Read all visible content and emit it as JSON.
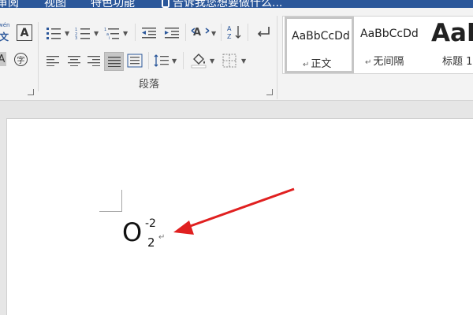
{
  "tabs": [
    {
      "label": "审阅"
    },
    {
      "label": "视图"
    },
    {
      "label": "特色功能"
    }
  ],
  "tell_me": {
    "text": "告诉我您想要做什么..."
  },
  "ribbon": {
    "pinyin_label": "wén",
    "pinyin_char": "文",
    "char_border_label": "A",
    "shading_label": "A",
    "enclose_label": "字",
    "group_label": "段落",
    "styles": [
      {
        "sample": "AaBbCcDd",
        "name": "正文",
        "mark": "↵"
      },
      {
        "sample": "AaBbCcDd",
        "name": "无间隔",
        "mark": "↵"
      },
      {
        "sample": "AaB",
        "name": "标题 1",
        "mark": ""
      }
    ]
  },
  "document": {
    "base": "O",
    "superscript": "-2",
    "subscript": "2",
    "paragraph_mark": "↵"
  },
  "colors": {
    "accent": "#2b579a",
    "arrow": "#e02020"
  }
}
